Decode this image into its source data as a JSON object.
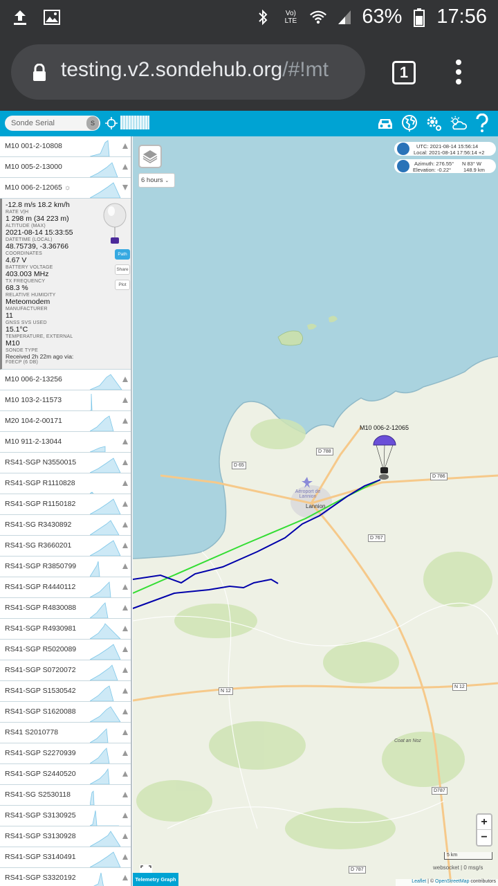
{
  "statusbar": {
    "battery": "63%",
    "time": "17:56",
    "network": "LTE"
  },
  "browser": {
    "url_main": "testing.v2.sondehub.org",
    "url_rest": "/#!mt",
    "tab_count": "1"
  },
  "header": {
    "search_placeholder": "Sonde Serial",
    "search_button": "S"
  },
  "sondes": [
    {
      "serial": "M10 001-2-10808",
      "arrow": "up"
    },
    {
      "serial": "M10 005-2-13000",
      "arrow": "up"
    },
    {
      "serial": "M10 006-2-12065",
      "arrow": "down",
      "expanded": true
    }
  ],
  "selected": {
    "rate": "-12.8 m/s 18.2 km/h",
    "rate_label": "RATE V|H",
    "altitude": "1 298 m (34 223 m)",
    "altitude_label": "ALTITUDE (MAX)",
    "datetime": "2021-08-14 15:33:55",
    "datetime_label": "DATETIME (LOCAL)",
    "coordinates": "48.75739, -3.36766",
    "coordinates_label": "COORDINATES",
    "battery": "4.67 V",
    "battery_label": "BATTERY VOLTAGE",
    "tx_freq": "403.003 MHz",
    "tx_freq_label": "TX FREQUENCY",
    "humidity": "68.3 %",
    "humidity_label": "RELATIVE HUMIDITY",
    "manufacturer": "Meteomodem",
    "manufacturer_label": "MANUFACTURER",
    "gnss": "11",
    "gnss_label": "GNSS SVS USED",
    "temperature": "15.1°C",
    "temperature_label": "TEMPERATURE, EXTERNAL",
    "type": "M10",
    "type_label": "SONDE TYPE",
    "received": "Received 2h 22m ago via:",
    "receiver": "F0ECP (6 DB)",
    "btn_path": "Path",
    "btn_share": "Share",
    "btn_plot": "Plot"
  },
  "sondes_rest": [
    "M10 006-2-13256",
    "M10 103-2-11573",
    "M20 104-2-00171",
    "M10 911-2-13044",
    "RS41-SGP N3550015",
    "RS41-SGP R1110828",
    "RS41-SGP R1150182",
    "RS41-SG R3430892",
    "RS41-SG R3660201",
    "RS41-SGP R3850799",
    "RS41-SGP R4440112",
    "RS41-SGP R4830088",
    "RS41-SGP R4930981",
    "RS41-SGP R5020089",
    "RS41-SGP S0720072",
    "RS41-SGP S1530542",
    "RS41-SGP S1620088",
    "RS41 S2010778",
    "RS41-SGP S2270939",
    "RS41-SGP S2440520",
    "RS41-SG S2530118",
    "RS41-SGP S3130925",
    "RS41-SGP S3130928",
    "RS41-SGP S3140491",
    "RS41-SGP S3320192"
  ],
  "map": {
    "time_select": "6 hours",
    "utc": "UTC: 2021-08-14 15:56:14",
    "local": "Local: 2021-08-14 17:56:14 +2",
    "azimuth": "Azimuth: 276.55°",
    "azimuth_dir": "N 83° W",
    "elevation": "Elevation: -0.22°",
    "distance": "148.9 km",
    "sonde_label": "M10 006-2-12065",
    "zoom_in": "+",
    "zoom_out": "−",
    "scale": "5 km",
    "websocket": "websocket | 0 msg/s",
    "attrib_leaflet": "Leaflet",
    "attrib_mid": " | © ",
    "attrib_osm": "OpenStreetMap",
    "attrib_end": " contributors",
    "telemetry_button": "Telemetry Graph",
    "places": {
      "airport": "Aéroport de Lannion",
      "lannion": "Lannion",
      "coat": "Coat an Noz"
    },
    "roads": [
      "D 788",
      "D 65",
      "D 786",
      "D 767",
      "N 12",
      "N 12",
      "D787",
      "D 787"
    ]
  },
  "colors": {
    "header_blue": "#00a3d3",
    "sea": "#aad3df",
    "track_blue": "#0000aa",
    "track_green": "#33dd33"
  }
}
